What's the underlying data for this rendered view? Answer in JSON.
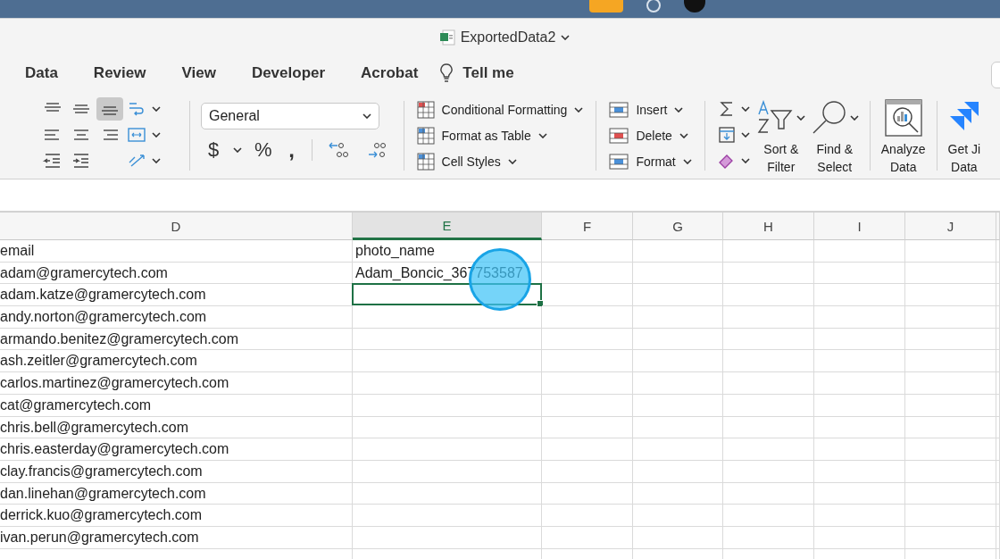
{
  "window": {
    "title": "ExportedData2"
  },
  "ribbon_tabs": [
    {
      "label": "Data"
    },
    {
      "label": "Review"
    },
    {
      "label": "View"
    },
    {
      "label": "Developer"
    },
    {
      "label": "Acrobat"
    }
  ],
  "tell_me": {
    "label": "Tell me"
  },
  "ribbon": {
    "vertical_align": [
      {
        "selected": false
      },
      {
        "selected": false
      },
      {
        "selected": true
      }
    ],
    "number_format": "General",
    "number_buttons": [
      "$",
      "%",
      ","
    ],
    "styles": [
      "Conditional Formatting",
      "Format as Table",
      "Cell Styles"
    ],
    "cells": [
      "Insert",
      "Delete",
      "Format"
    ],
    "sort_filter": [
      "Sort &",
      "Filter"
    ],
    "find_select": [
      "Find &",
      "Select"
    ],
    "analyze": [
      "Analyze",
      "Data"
    ],
    "jira": [
      "Get Ji",
      "Data"
    ]
  },
  "sheet": {
    "columns": [
      {
        "label": "D",
        "selected": false
      },
      {
        "label": "E",
        "selected": true
      },
      {
        "label": "F",
        "selected": false
      },
      {
        "label": "G",
        "selected": false
      },
      {
        "label": "H",
        "selected": false
      },
      {
        "label": "I",
        "selected": false
      },
      {
        "label": "J",
        "selected": false
      }
    ],
    "rows": [
      {
        "d": "email",
        "e": "photo_name",
        "e_selected": false
      },
      {
        "d": "adam@gramercytech.com",
        "e": "Adam_Boncic_367753587",
        "e_selected": false
      },
      {
        "d": "adam.katze@gramercytech.com",
        "e_selected": true
      },
      {
        "d": "andy.norton@gramercytech.com",
        "e_selected": false
      },
      {
        "d": "armando.benitez@gramercytech.com",
        "e_selected": false
      },
      {
        "d": "ash.zeitler@gramercytech.com",
        "e_selected": false
      },
      {
        "d": "carlos.martinez@gramercytech.com",
        "e_selected": false
      },
      {
        "d": "cat@gramercytech.com",
        "e_selected": false
      },
      {
        "d": "chris.bell@gramercytech.com",
        "e_selected": false
      },
      {
        "d": "chris.easterday@gramercytech.com",
        "e_selected": false
      },
      {
        "d": "clay.francis@gramercytech.com",
        "e_selected": false
      },
      {
        "d": "dan.linehan@gramercytech.com",
        "e_selected": false
      },
      {
        "d": "derrick.kuo@gramercytech.com",
        "e_selected": false
      },
      {
        "d": "ivan.perun@gramercytech.com",
        "e_selected": false
      }
    ]
  }
}
